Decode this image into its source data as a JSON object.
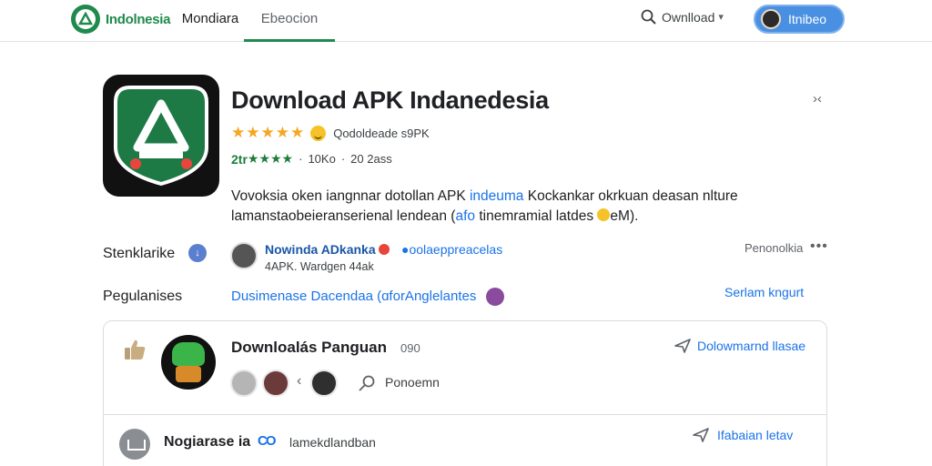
{
  "nav": {
    "brand": "Indolnesia",
    "tabs": [
      {
        "label": "Mondiara"
      },
      {
        "label": "Ebeocion"
      }
    ],
    "search_label": "Ownlload",
    "account_label": "Itnibeo"
  },
  "app": {
    "title": "Download APK Indanedesia",
    "rating_text": "Qodoldeade s9PK",
    "stats_prefix": "2tr",
    "stats_downloads": "10Ko",
    "stats_reviews": "20 2ass",
    "description_line1_pre": "Vovoksia oken iangnnar dotollan APK ",
    "description_line1_link": "indeuma",
    "description_line1_post": " Kockankar okrkuan deasan nlture",
    "description_line2_pre": "lamanstaobeieranserienal lendean (",
    "description_line2_link": "afo",
    "description_line2_post": " tinemramial latdes ",
    "description_line2_end": "eM)."
  },
  "developer": {
    "row_label": "Stenklarike",
    "name": "Nowinda ADkanka",
    "extra": "●oolaeppreacelas",
    "sub": "4APK. Wardgen 44ak",
    "more_label": "Penonolkia",
    "more_dots": "•••"
  },
  "permissions": {
    "row_label": "Pegulanises",
    "link": "Dusimenase Dacendaa (ɑforAnglelantes",
    "see_label": "Serlam kngurt"
  },
  "reviews": {
    "card1": {
      "title": "Downloalás Panguan",
      "count": "090",
      "action": "Dolowmarnd llasae",
      "reply_label": "Ponoemn"
    },
    "card2": {
      "title": "Nogiarase ia",
      "badge": "CO",
      "sub": "lamekdlandban",
      "action": "Ifabaian letav"
    }
  },
  "colors": {
    "brand_green": "#1f8a4c",
    "link_blue": "#1a73e8",
    "star": "#f5a623",
    "account_blue": "#4a90e2"
  },
  "icons": [
    "brand-logo-icon",
    "search-icon",
    "chevron-down-icon",
    "close-icon",
    "star-icon",
    "smiley-icon",
    "info-icon",
    "thumbs-up-icon",
    "share-icon",
    "pin-icon",
    "inbox-icon"
  ]
}
